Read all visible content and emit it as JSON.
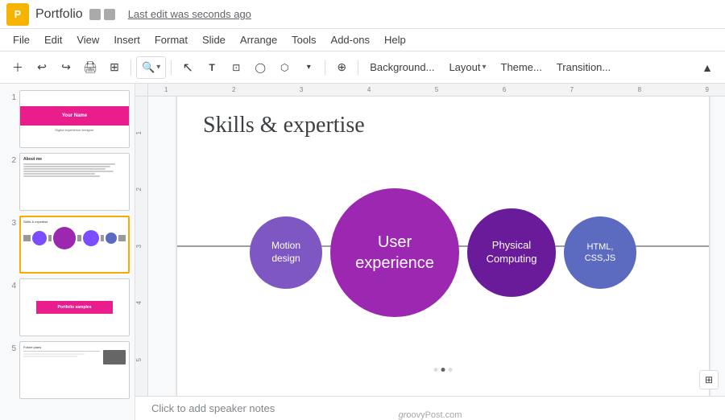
{
  "titleBar": {
    "appIcon": "P",
    "docTitle": "Portfolio",
    "lastEdit": "Last edit was seconds ago"
  },
  "menuBar": {
    "items": [
      "File",
      "Edit",
      "View",
      "Insert",
      "Format",
      "Slide",
      "Arrange",
      "Tools",
      "Add-ons",
      "Help"
    ]
  },
  "toolbar": {
    "zoomLevel": "▾",
    "buttons": [
      "＋",
      "↩",
      "↪",
      "🖨",
      "⊞",
      "🔍",
      "▾",
      "↖",
      "⊡",
      "◯",
      "⬡",
      "▾",
      "⊕"
    ],
    "actionButtons": [
      "Background...",
      "Layout ▾",
      "Theme...",
      "Transition..."
    ],
    "collapseIcon": "▲"
  },
  "sidebar": {
    "slides": [
      {
        "num": 1,
        "label": "Your Name slide"
      },
      {
        "num": 2,
        "label": "About me slide"
      },
      {
        "num": 3,
        "label": "Skills & expertise slide",
        "active": true
      },
      {
        "num": 4,
        "label": "Portfolio samples slide"
      },
      {
        "num": 5,
        "label": "Future plans slide"
      }
    ]
  },
  "slide": {
    "title": "Skills & expertise",
    "circles": [
      {
        "label": "Motion\ndesign",
        "size": "small",
        "color": "purple-light"
      },
      {
        "label": "User\nexperience",
        "size": "large",
        "color": "purple-main"
      },
      {
        "label": "Physical\nComputing",
        "size": "medium",
        "color": "purple-dark"
      },
      {
        "label": "HTML,\nCSS,JS",
        "size": "small",
        "color": "blue-purple"
      }
    ],
    "speakerNotes": "Click to add speaker notes"
  },
  "slidePreview1": {
    "name": "Your Name",
    "subtitle": "Digital experience designer"
  },
  "slidePreview2": {
    "title": "About me"
  },
  "slidePreview4": {
    "text": "Portfolio samples"
  },
  "slidePreview5": {
    "title": "Future plans"
  }
}
